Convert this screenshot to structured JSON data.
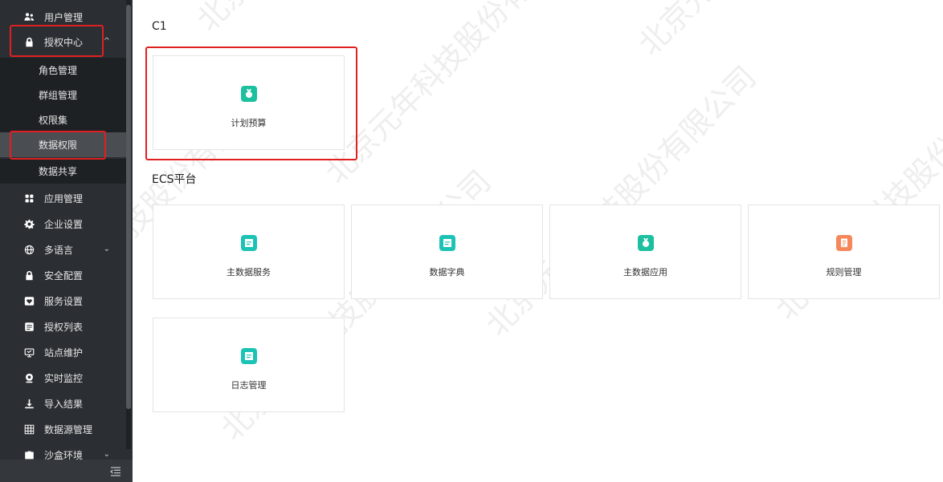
{
  "sidebar": {
    "items": [
      {
        "label": "用户管理",
        "icon": "users-icon"
      },
      {
        "label": "授权中心",
        "icon": "lock-icon",
        "chevron": "^"
      },
      {
        "label": "角色管理"
      },
      {
        "label": "群组管理"
      },
      {
        "label": "权限集"
      },
      {
        "label": "数据权限"
      },
      {
        "label": "数据共享"
      },
      {
        "label": "应用管理",
        "icon": "apps-icon"
      },
      {
        "label": "企业设置",
        "icon": "gear-icon"
      },
      {
        "label": "多语言",
        "icon": "globe-icon",
        "chevron": "⌄"
      },
      {
        "label": "安全配置",
        "icon": "lock-icon"
      },
      {
        "label": "服务设置",
        "icon": "heart-icon"
      },
      {
        "label": "授权列表",
        "icon": "list-icon"
      },
      {
        "label": "站点维护",
        "icon": "monitor-icon"
      },
      {
        "label": "实时监控",
        "icon": "webcam-icon"
      },
      {
        "label": "导入结果",
        "icon": "download-icon"
      },
      {
        "label": "数据源管理",
        "icon": "grid-icon"
      },
      {
        "label": "沙盒环境",
        "icon": "briefcase-icon",
        "chevron": "⌄"
      }
    ]
  },
  "sections": [
    {
      "title": "C1",
      "cards": [
        {
          "name": "计划预算",
          "icon": "medal-icon",
          "color": "#1cc09e"
        }
      ]
    },
    {
      "title": "ECS平台",
      "cards": [
        {
          "name": "主数据服务",
          "icon": "document-icon",
          "color": "#1cc3b5"
        },
        {
          "name": "数据字典",
          "icon": "document-icon",
          "color": "#1cc3b5"
        },
        {
          "name": "主数据应用",
          "icon": "medal-icon",
          "color": "#1cc09e"
        },
        {
          "name": "规则管理",
          "icon": "receipt-icon",
          "color": "#f5875a"
        },
        {
          "name": "日志管理",
          "icon": "document-icon",
          "color": "#1cc3b5"
        }
      ]
    }
  ],
  "watermark": "北京元年科技股份有限公司",
  "colors": {
    "sidebar_bg": "#2b2f33",
    "submenu_bg": "#1e2124",
    "highlight_red": "#e02020"
  }
}
